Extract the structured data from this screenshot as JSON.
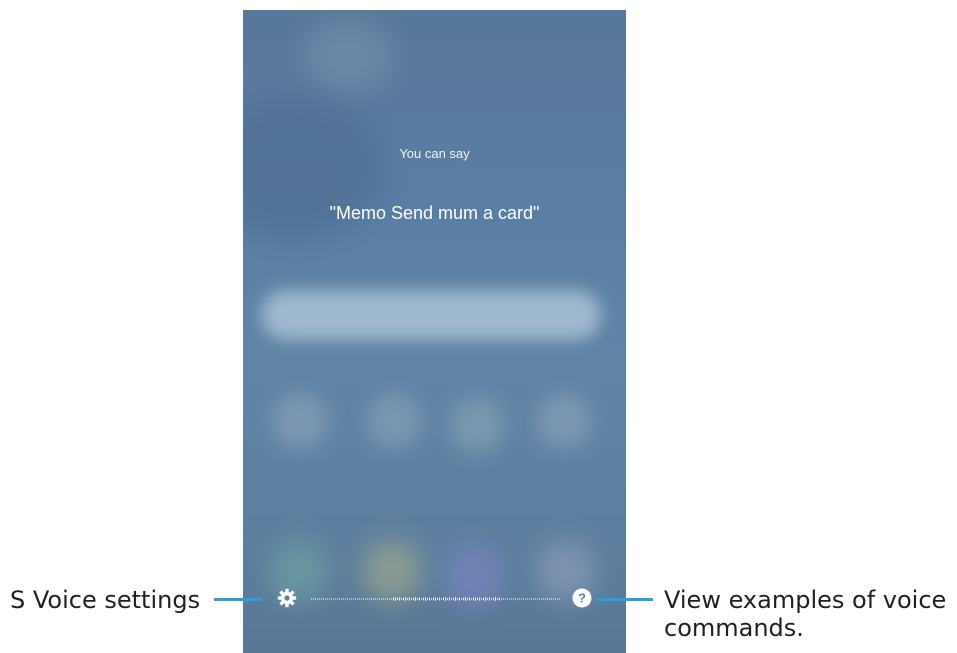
{
  "screen": {
    "hint_label": "You can say",
    "hint_example": "\"Memo Send mum a card\""
  },
  "icons": {
    "settings": "gear-icon",
    "help": "help-icon"
  },
  "callouts": {
    "settings_label": "S Voice settings",
    "help_label_line1": "View examples of voice",
    "help_label_line2": "commands."
  },
  "colors": {
    "callout_line": "#2c9fd4",
    "screen_bg": "#5a7ea3"
  }
}
